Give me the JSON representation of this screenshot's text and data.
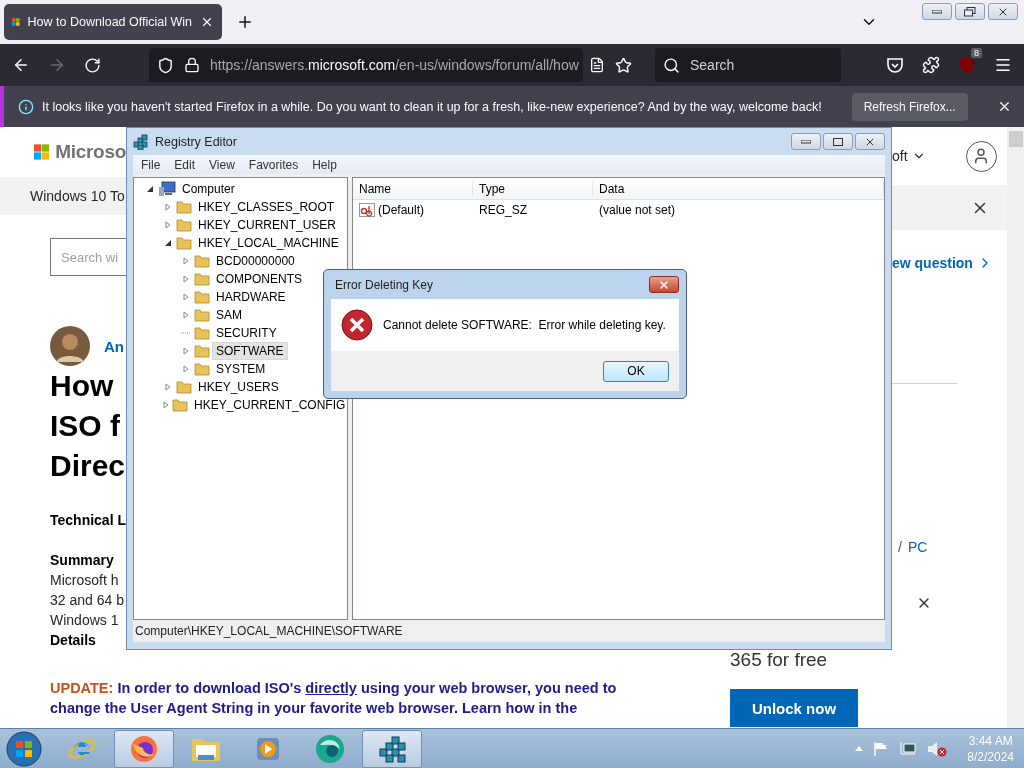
{
  "browser": {
    "tabs": [
      {
        "title": "How to Download Official Win",
        "selected": true
      }
    ],
    "url": {
      "prefix": "https://answers.",
      "domain": "microsoft.com",
      "path": "/en-us/windows/forum/all/how"
    },
    "search": {
      "placeholder": "Search"
    },
    "extension_badge": "8",
    "notification": {
      "message": "It looks like you haven't started Firefox in a while. Do you want to clean it up for a fresh, like-new experience? And by the way, welcome back!",
      "button": "Refresh Firefox..."
    }
  },
  "page": {
    "left": {
      "logo_text": "Microso",
      "topic_bar": "Windows 10 To",
      "search": {
        "placeholder": "Search wi"
      },
      "author": "An",
      "title_lines": [
        "How",
        "ISO f",
        "Direc"
      ],
      "label": "Technical L",
      "summary_heading": "Summary",
      "summary_lines": [
        "Microsoft h",
        "32 and 64 b",
        "Windows 1"
      ],
      "details_heading": "Details"
    },
    "right": {
      "account_text": "oft",
      "new_question": "ew question",
      "breadcrumb_separator": "/",
      "breadcrumb_link": "PC"
    },
    "update": {
      "label": "UPDATE:",
      "before_link": "In order to download ISO's",
      "link": "directly",
      "after_link": "using your web browser, you need to change the User Agent String in your favorite web browser. Learn how in the"
    },
    "promo": {
      "text": "365 for free",
      "button": "Unlock now"
    }
  },
  "registry_editor": {
    "title": "Registry Editor",
    "menu": [
      "File",
      "Edit",
      "View",
      "Favorites",
      "Help"
    ],
    "tree": [
      {
        "label": "Computer",
        "kind": "computer",
        "has_children": true,
        "expanded": true,
        "selected": false,
        "children": [
          {
            "label": "HKEY_CLASSES_ROOT",
            "kind": "folder",
            "has_children": true,
            "expanded": false,
            "selected": false
          },
          {
            "label": "HKEY_CURRENT_USER",
            "kind": "folder",
            "has_children": true,
            "expanded": false,
            "selected": false
          },
          {
            "label": "HKEY_LOCAL_MACHINE",
            "kind": "folder",
            "has_children": true,
            "expanded": true,
            "selected": false,
            "children": [
              {
                "label": "BCD00000000",
                "kind": "folder",
                "has_children": true,
                "expanded": false,
                "selected": false
              },
              {
                "label": "COMPONENTS",
                "kind": "folder",
                "has_children": true,
                "expanded": false,
                "selected": false
              },
              {
                "label": "HARDWARE",
                "kind": "folder",
                "has_children": true,
                "expanded": false,
                "selected": false
              },
              {
                "label": "SAM",
                "kind": "folder",
                "has_children": true,
                "expanded": false,
                "selected": false
              },
              {
                "label": "SECURITY",
                "kind": "folder",
                "has_children": false,
                "selected": false
              },
              {
                "label": "SOFTWARE",
                "kind": "folder",
                "has_children": true,
                "expanded": false,
                "selected": true
              },
              {
                "label": "SYSTEM",
                "kind": "folder",
                "has_children": true,
                "expanded": false,
                "selected": false
              }
            ]
          },
          {
            "label": "HKEY_USERS",
            "kind": "folder",
            "has_children": true,
            "expanded": false,
            "selected": false
          },
          {
            "label": "HKEY_CURRENT_CONFIG",
            "kind": "folder",
            "has_children": true,
            "expanded": false,
            "selected": false
          }
        ]
      }
    ],
    "columns": [
      "Name",
      "Type",
      "Data"
    ],
    "rows": [
      {
        "name": "(Default)",
        "type": "REG_SZ",
        "data": "(value not set)"
      }
    ],
    "status": "Computer\\HKEY_LOCAL_MACHINE\\SOFTWARE"
  },
  "dialog": {
    "title": "Error Deleting Key",
    "message": "Cannot delete SOFTWARE:  Error while deleting key.",
    "button": "OK"
  },
  "taskbar": {
    "items": [
      {
        "kind": "ie",
        "active": false
      },
      {
        "kind": "firefox",
        "active": true
      },
      {
        "kind": "folder",
        "active": false
      },
      {
        "kind": "media",
        "active": false
      },
      {
        "kind": "globe",
        "active": false
      },
      {
        "kind": "registry",
        "active": true
      }
    ],
    "time": "3:44 AM",
    "date": "8/2/2024"
  }
}
